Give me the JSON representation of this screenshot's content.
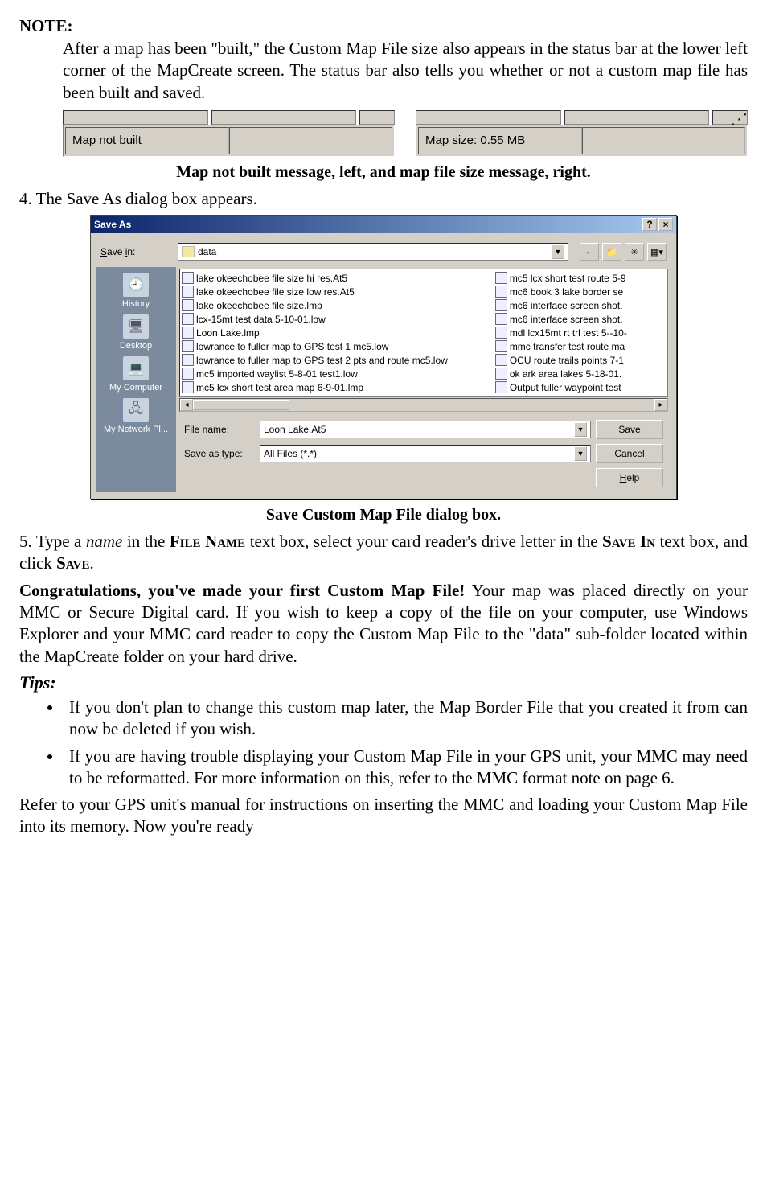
{
  "note_heading": "NOTE:",
  "note_para": "After a map has been \"built,\" the Custom Map File size also appears in the status bar at the lower left corner of the MapCreate screen. The status bar also tells you whether or not a custom map file has been built and saved.",
  "statusbar_left": "Map not built",
  "statusbar_right": "Map size: 0.55 MB",
  "caption1": "Map not built message, left, and map file size message, right.",
  "step4": "4. The Save As dialog box appears.",
  "dialog": {
    "title": "Save As",
    "help_glyph": "?",
    "close_glyph": "×",
    "savein_label": "Save in:",
    "savein_value": "data",
    "back_glyph": "←",
    "up_glyph": "📁",
    "new_glyph": "✦",
    "view_glyph": "▦▾",
    "places": {
      "history": "History",
      "desktop": "Desktop",
      "mycomputer": "My Computer",
      "mynetwork": "My Network Pl..."
    },
    "files_left": [
      "lake okeechobee file size hi res.At5",
      "lake okeechobee file size low res.At5",
      "lake okeechobee file size.lmp",
      "lcx-15mt test data 5-10-01.low",
      "Loon Lake.lmp",
      "lowrance to fuller map to GPS test 1 mc5.low",
      "lowrance to fuller map to GPS test 2 pts and route mc5.low",
      "mc5 imported waylist 5-8-01 test1.low",
      "mc5 lcx short test area map 6-9-01.lmp"
    ],
    "files_right": [
      "mc5 lcx short test route 5-9",
      "mc6 book 3 lake border se",
      "mc6 interface screen shot.",
      "mc6 interface screen shot.",
      "mdl lcx15mt rt trl test 5--10-",
      "mmc transfer test route ma",
      "OCU route trails points 7-1",
      "ok ark area lakes 5-18-01.",
      "Output fuller waypoint test"
    ],
    "filename_label": "File name:",
    "filename_value": "Loon Lake.At5",
    "savetype_label": "Save as type:",
    "savetype_value": "All Files (*.*)",
    "save_btn": "Save",
    "cancel_btn": "Cancel",
    "help_btn": "Help"
  },
  "caption2": "Save Custom Map File dialog box.",
  "step5_a": "5. Type a ",
  "step5_name": "name",
  "step5_b": " in the ",
  "step5_filename": "File Name",
  "step5_c": " text box, select your card reader's drive letter in the ",
  "step5_savein": "Save In",
  "step5_d": " text box, and click ",
  "step5_save": "Save",
  "step5_e": ".",
  "congrats_bold": "Congratulations, you've made your first Custom Map File!",
  "congrats_rest": " Your map was placed directly on your MMC or Secure Digital card. If you wish to keep a copy of the file on your computer, use Windows Explorer and your MMC card reader to copy the Custom Map File to the \"data\" sub-folder located within the MapCreate folder on your hard drive.",
  "tips_heading": "Tips:",
  "tip1": "If you don't plan to change this custom map later, the Map Border File that you created it from can now be deleted if you wish.",
  "tip2": "If you are having trouble displaying your Custom Map File in your GPS unit, your MMC may need to be reformatted. For more information on this, refer to the MMC format note on page 6.",
  "final_para": "Refer to your GPS unit's manual for instructions on inserting the MMC and loading your Custom Map File into its memory. Now you're ready"
}
